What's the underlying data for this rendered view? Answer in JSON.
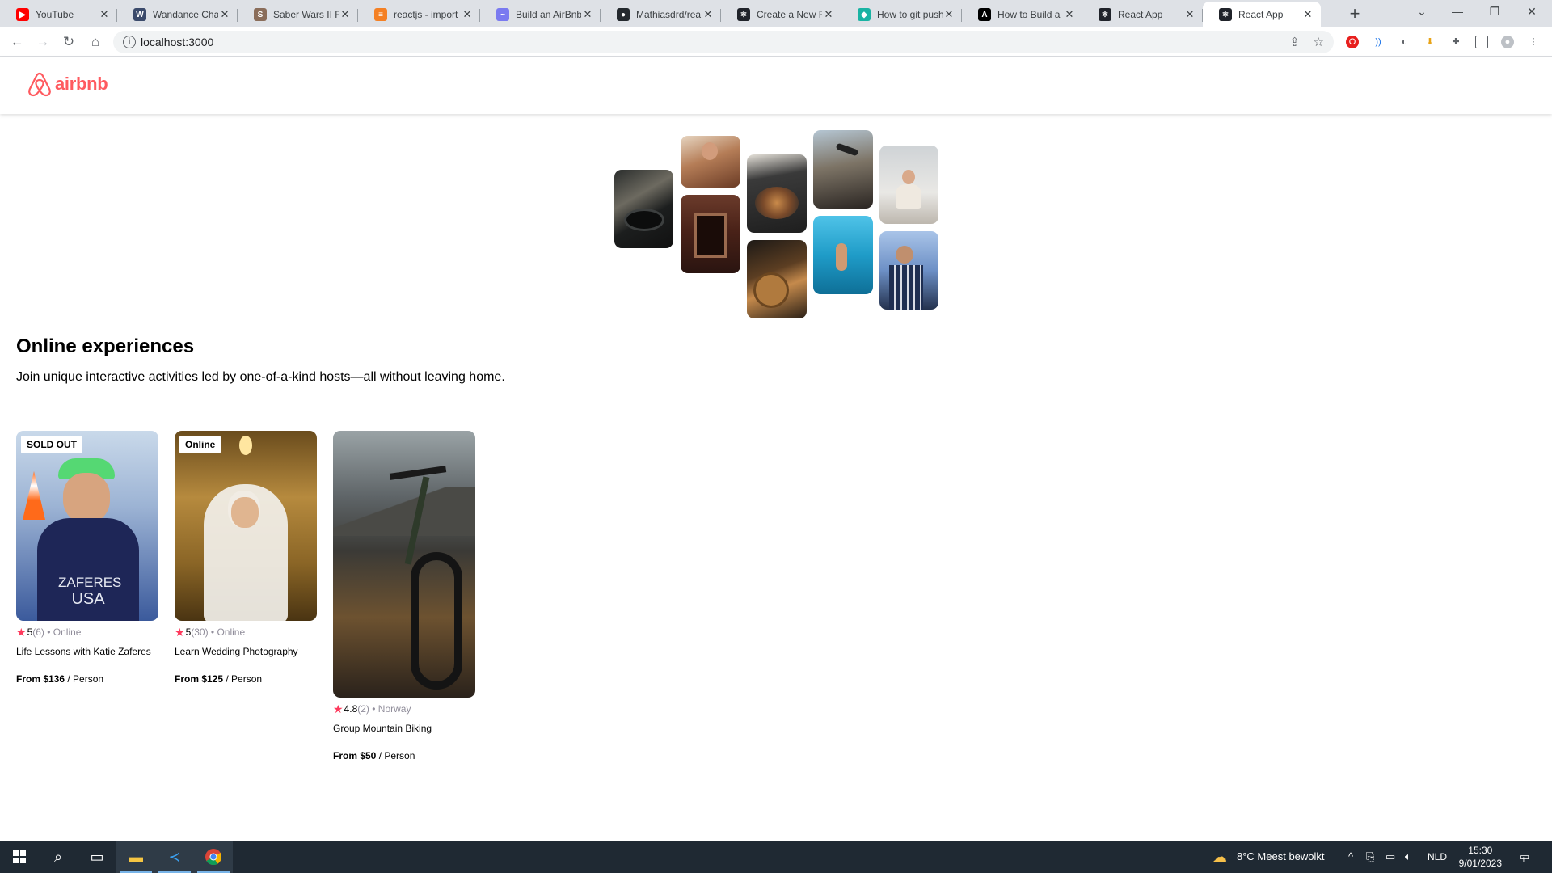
{
  "browser": {
    "tabs": [
      {
        "title": "YouTube",
        "favicon": "youtube-icon",
        "color": "#FF0000",
        "glyph": "▶"
      },
      {
        "title": "Wandance Chap",
        "favicon": "book-icon",
        "color": "#3b4a6b",
        "glyph": "W"
      },
      {
        "title": "Saber Wars II Re",
        "favicon": "manga-icon",
        "color": "#8a6d5a",
        "glyph": "S"
      },
      {
        "title": "reactjs - import",
        "favicon": "stackoverflow-icon",
        "color": "#F48024",
        "glyph": "≡"
      },
      {
        "title": "Build an AirBnb",
        "favicon": "scrimba-icon",
        "color": "#7a7af0",
        "glyph": "~"
      },
      {
        "title": "Mathiasdrd/rea",
        "favicon": "github-icon",
        "color": "#24292e",
        "glyph": "●"
      },
      {
        "title": "Create a New Re",
        "favicon": "react-icon",
        "color": "#20232a",
        "glyph": "⚛"
      },
      {
        "title": "How to git push",
        "favicon": "freecodecamp-icon",
        "color": "#19b3a3",
        "glyph": "◆"
      },
      {
        "title": "How to Build a R",
        "favicon": "medium-icon",
        "color": "#000000",
        "glyph": "A"
      },
      {
        "title": "React App",
        "favicon": "react-icon",
        "color": "#20232a",
        "glyph": "⚛"
      },
      {
        "title": "React App",
        "favicon": "react-icon",
        "color": "#20232a",
        "glyph": "⚛"
      }
    ],
    "address": "localhost:3000"
  },
  "app": {
    "brand": "airbnb",
    "brand_color": "#FF5A5F",
    "hero": {
      "title": "Online experiences",
      "text": "Join unique interactive activities led by one-of-a-kind hosts—all without leaving home."
    },
    "cards": [
      {
        "badge": "SOLD OUT",
        "rating": "5",
        "count": "(6)",
        "location": "Online",
        "title": "Life Lessons with Katie Zaferes",
        "price_label": "From $136",
        "unit": "/ Person"
      },
      {
        "badge": "Online",
        "rating": "5",
        "count": "(30)",
        "location": "Online",
        "title": "Learn Wedding Photography",
        "price_label": "From $125",
        "unit": "/ Person"
      },
      {
        "badge": "",
        "rating": "4.8",
        "count": "(2)",
        "location": "Norway",
        "title": "Group Mountain Biking",
        "price_label": "From $50",
        "unit": "/ Person"
      }
    ],
    "jersey_text": {
      "line1": "ZAFERES",
      "line2": "USA"
    }
  },
  "taskbar": {
    "weather": "8°C  Meest bewolkt",
    "language": "NLD",
    "time": "15:30",
    "date": "9/01/2023",
    "notifications": "1"
  }
}
